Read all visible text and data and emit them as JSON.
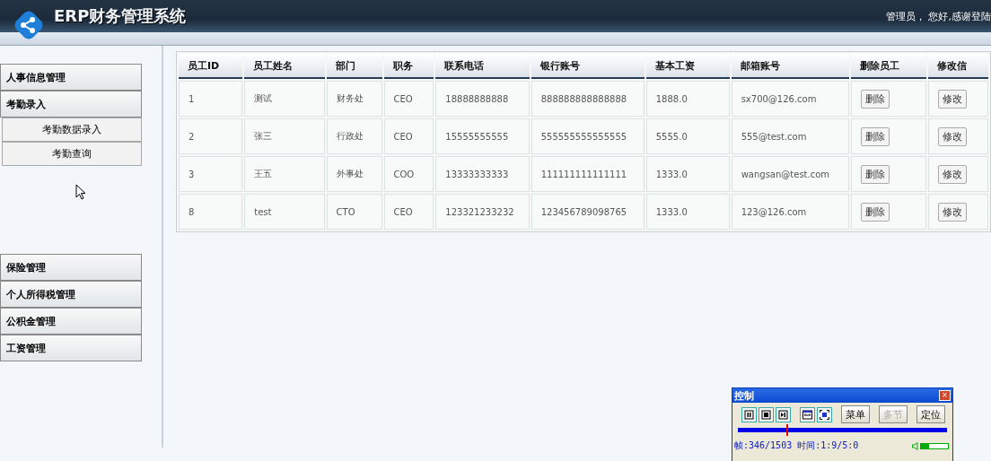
{
  "header": {
    "title": "ERP财务管理系统",
    "greeting": "管理员， 您好,感谢登陆"
  },
  "sidebar": {
    "sections": [
      {
        "items": [
          {
            "kind": "menu",
            "label": "人事信息管理"
          },
          {
            "kind": "menu",
            "label": "考勤录入"
          },
          {
            "kind": "submenu",
            "label": "考勤数据录入"
          },
          {
            "kind": "submenu",
            "label": "考勤查询"
          }
        ]
      },
      {
        "items": [
          {
            "kind": "menu",
            "label": "保险管理"
          },
          {
            "kind": "menu",
            "label": "个人所得税管理"
          },
          {
            "kind": "menu",
            "label": "公积金管理"
          },
          {
            "kind": "menu",
            "label": "工资管理"
          }
        ]
      }
    ]
  },
  "table": {
    "columns": [
      "员工ID",
      "员工姓名",
      "部门",
      "职务",
      "联系电话",
      "银行账号",
      "基本工资",
      "邮箱账号",
      "删除员工",
      "修改信"
    ],
    "rows": [
      {
        "cells": [
          "1",
          "测试",
          "财务处",
          "CEO",
          "18888888888",
          "888888888888888",
          "1888.0",
          "sx700@126.com"
        ],
        "delete": "删除",
        "edit": "修改"
      },
      {
        "cells": [
          "2",
          "张三",
          "行政处",
          "CEO",
          "15555555555",
          "555555555555555",
          "5555.0",
          "555@test.com"
        ],
        "delete": "删除",
        "edit": "修改"
      },
      {
        "cells": [
          "3",
          "王五",
          "外事处",
          "COO",
          "13333333333",
          "111111111111111",
          "1333.0",
          "wangsan@test.com"
        ],
        "delete": "删除",
        "edit": "修改"
      },
      {
        "cells": [
          "8",
          "test",
          "CTO",
          "CEO",
          "123321233232",
          "123456789098765",
          "1333.0",
          "123@126.com"
        ],
        "delete": "删除",
        "edit": "修改"
      }
    ]
  },
  "player": {
    "title": "控制",
    "close": "×",
    "buttons": [
      {
        "label": "菜单",
        "disabled": false
      },
      {
        "label": "多节",
        "disabled": true
      },
      {
        "label": "定位",
        "disabled": false
      }
    ],
    "progress": {
      "level": 0.23
    },
    "status": "帧:346/1503 时间:1:9/5:0",
    "volume": {
      "level": 0.3
    }
  }
}
